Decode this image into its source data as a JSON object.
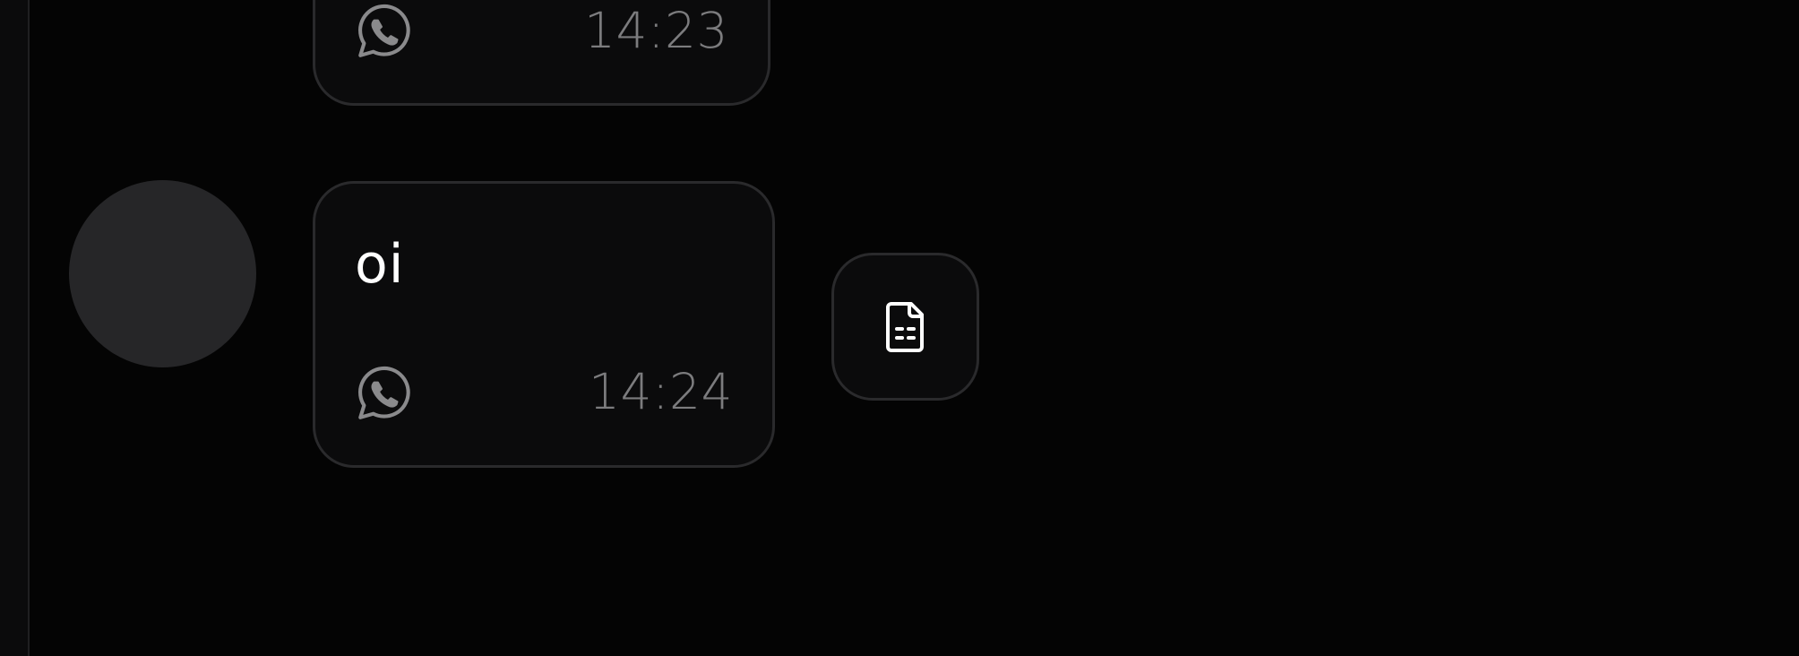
{
  "messages": [
    {
      "text": "",
      "time": "14:23",
      "channel_icon": "whatsapp-icon"
    },
    {
      "text": "oi",
      "time": "14:24",
      "channel_icon": "whatsapp-icon"
    }
  ],
  "actions": {
    "document_button_icon": "file-document-icon"
  },
  "colors": {
    "background": "#040404",
    "bubble": "#0b0b0c",
    "bubble_border": "#2a2a2c",
    "avatar": "#262628",
    "timestamp": "#7c7c7e",
    "icon": "#8a8a8c",
    "text": "#ffffff"
  }
}
